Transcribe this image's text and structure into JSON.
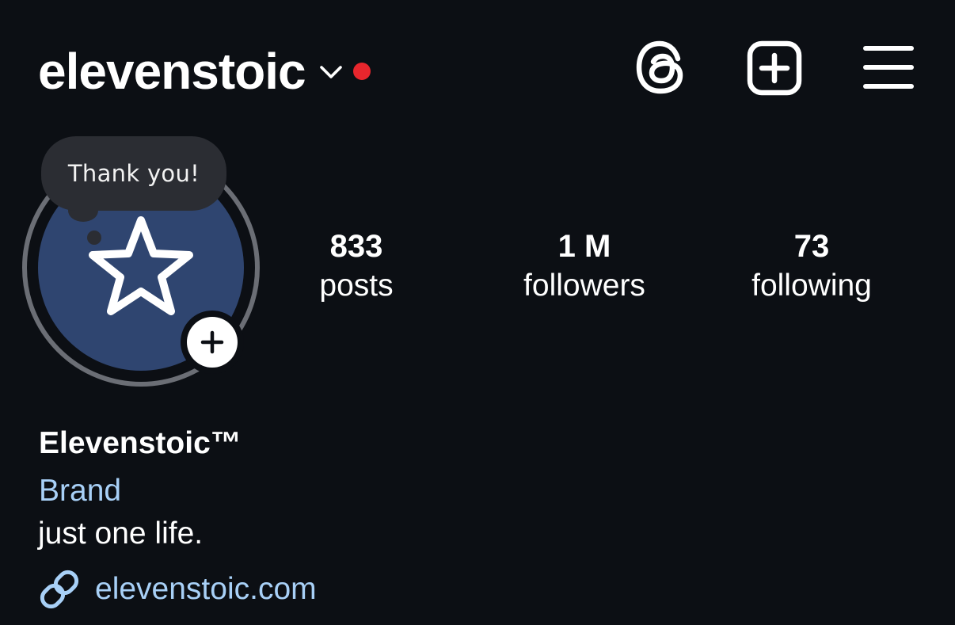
{
  "colors": {
    "background": "#0c0f14",
    "text": "#ffffff",
    "notification_dot": "#e8262d",
    "link_accent": "#a8d0f7",
    "avatar_fill": "#2f4570",
    "avatar_ring": "#6b6e75",
    "note_bubble": "#2b2d33"
  },
  "header": {
    "username": "elevenstoic",
    "chevron_icon": "chevron-down-icon",
    "threads_icon": "threads-icon",
    "new_post_icon": "plus-square-icon",
    "menu_icon": "hamburger-menu-icon"
  },
  "profile": {
    "note": "Thank you!",
    "avatar_icon": "star-icon",
    "add_story_icon": "plus-icon"
  },
  "stats": [
    {
      "count": "833",
      "label": "posts"
    },
    {
      "count": "1 M",
      "label": "followers"
    },
    {
      "count": "73",
      "label": "following"
    }
  ],
  "bio": {
    "display_name": "Elevenstoic™",
    "category": "Brand",
    "text": "just one life.",
    "link_icon": "link-icon",
    "link": "elevenstoic.com"
  }
}
